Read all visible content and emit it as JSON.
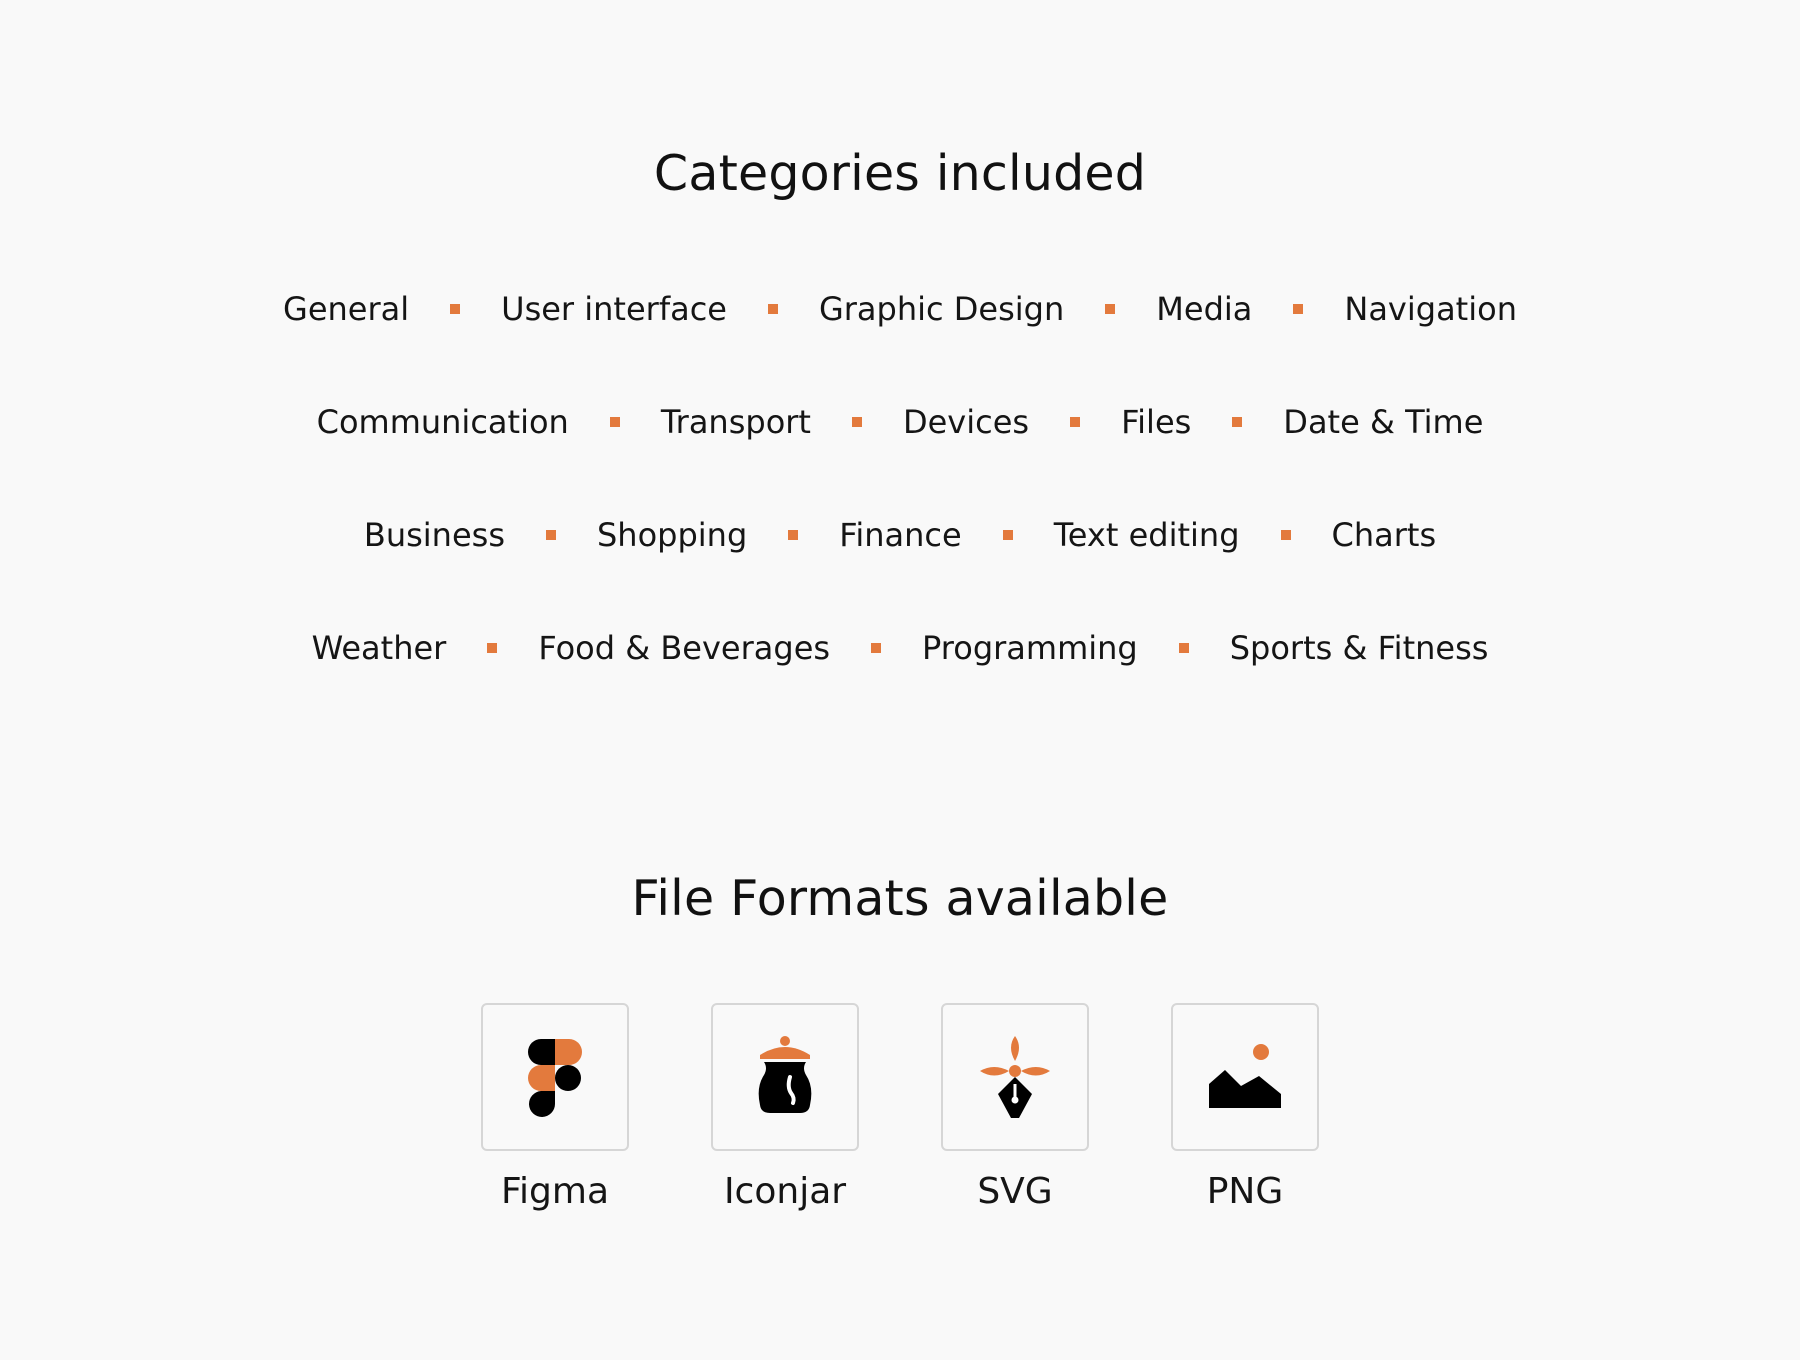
{
  "categories": {
    "title": "Categories included",
    "rows": [
      [
        "General",
        "User interface",
        "Graphic Design",
        "Media",
        "Navigation"
      ],
      [
        "Communication",
        "Transport",
        "Devices",
        "Files",
        "Date & Time"
      ],
      [
        "Business",
        "Shopping",
        "Finance",
        "Text editing",
        "Charts"
      ],
      [
        "Weather",
        "Food & Beverages",
        "Programming",
        "Sports & Fitness"
      ]
    ]
  },
  "formats": {
    "title": "File Formats available",
    "items": [
      {
        "label": "Figma",
        "icon": "figma-icon"
      },
      {
        "label": "Iconjar",
        "icon": "jar-icon"
      },
      {
        "label": "SVG",
        "icon": "pen-nib-icon"
      },
      {
        "label": "PNG",
        "icon": "image-icon"
      }
    ]
  },
  "colors": {
    "accent": "#e37a3d",
    "text": "#111111",
    "background": "#f9f9f9",
    "box_border": "#d6d6d6"
  }
}
